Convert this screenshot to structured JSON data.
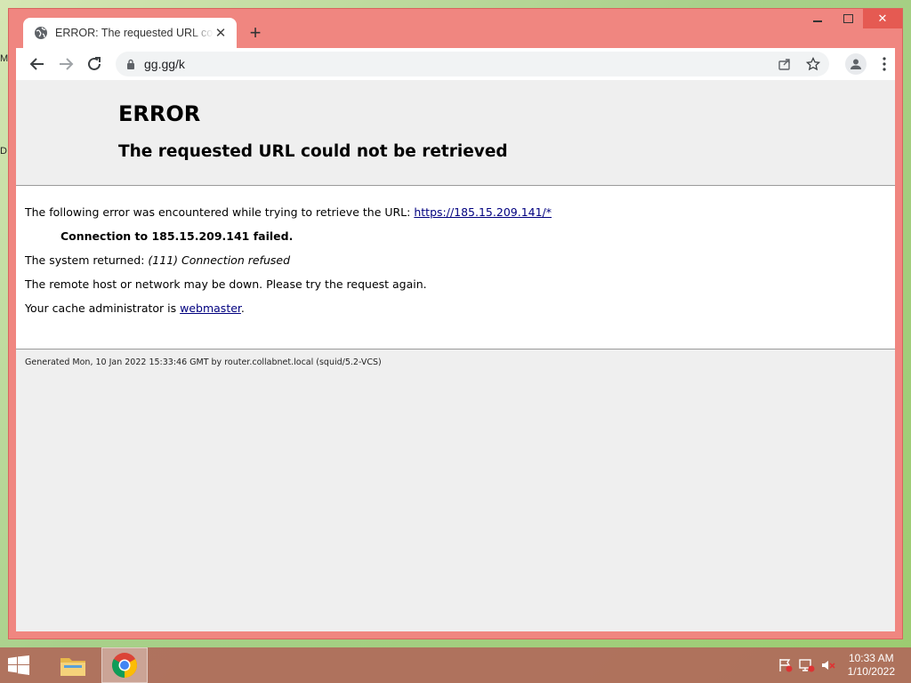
{
  "desktop": {
    "stub_1": "M",
    "stub_2": "D"
  },
  "browser": {
    "tab_title": "ERROR: The requested URL could not be retrieved",
    "address": "gg.gg/k",
    "controls": {
      "minimize": "—",
      "maximize": "☐",
      "close": "✕"
    }
  },
  "page": {
    "heading": "ERROR",
    "subheading": "The requested URL could not be retrieved",
    "line1_text": "The following error was encountered while trying to retrieve the URL: ",
    "line1_link": "https://185.15.209.141/*",
    "line2": "Connection to 185.15.209.141 failed.",
    "line3_prefix": "The system returned: ",
    "line3_italic": "(111) Connection refused",
    "line4": "The remote host or network may be down. Please try the request again.",
    "line5_prefix": "Your cache administrator is ",
    "line5_link": "webmaster",
    "line5_suffix": ".",
    "footer": "Generated Mon, 10 Jan 2022 15:33:46 GMT by router.collabnet.local (squid/5.2-VCS)"
  },
  "taskbar": {
    "time": "10:33 AM",
    "date": "1/10/2022"
  },
  "colors": {
    "window_frame": "#f08680",
    "link": "#00007f",
    "taskbar": "#b06a5a"
  }
}
